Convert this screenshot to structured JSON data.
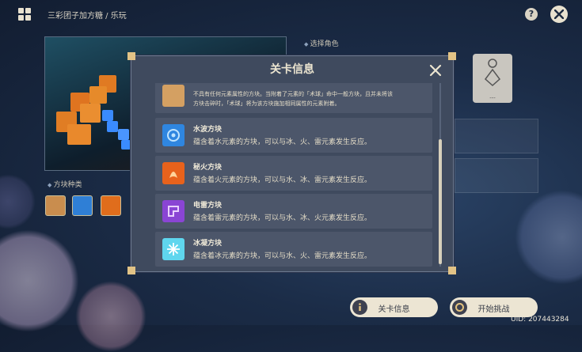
{
  "breadcrumb": "三彩团子加方糖 / 乐玩",
  "help_label": "?",
  "preview_section": {
    "label": "方块种类"
  },
  "character_section": {
    "label": "选择角色",
    "slot_caption": "---"
  },
  "modal": {
    "title": "关卡信息",
    "items": [
      {
        "name": "",
        "desc_lines": [
          "不具有任何元素属性的方块。当附着了元素的「术球」命中一般方块，且并未将该",
          "方块击碎时，「术球」将为该方块施加相同属性的元素附着。"
        ],
        "color": "#d4a062"
      },
      {
        "name": "水波方块",
        "desc": "蕴含着水元素的方块，可以与冰、火、雷元素发生反应。",
        "color": "#2f86e0"
      },
      {
        "name": "秘火方块",
        "desc": "蕴含着火元素的方块，可以与水、冰、雷元素发生反应。",
        "color": "#e8621c"
      },
      {
        "name": "电雷方块",
        "desc": "蕴含着雷元素的方块，可以与水、冰、火元素发生反应。",
        "color": "#8a45d4"
      },
      {
        "name": "冰凝方块",
        "desc": "蕴含着冰元素的方块，可以与水、火、雷元素发生反应。",
        "color": "#5fd6ee"
      }
    ]
  },
  "swatches": [
    {
      "color": "#c98d4e"
    },
    {
      "color": "#2f7fd6"
    },
    {
      "color": "#e06d1c"
    }
  ],
  "buttons": {
    "info": "关卡信息",
    "start": "开始挑战"
  },
  "uid": "UID: 207443284",
  "icons": [
    "app-grid-icon",
    "help-icon",
    "close-icon",
    "character-silhouette-icon",
    "info-icon",
    "target-icon"
  ]
}
